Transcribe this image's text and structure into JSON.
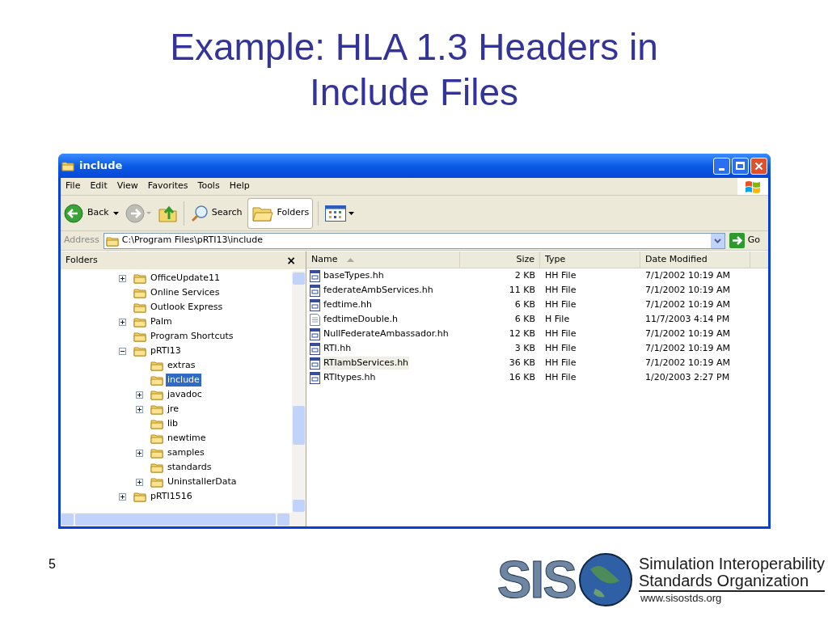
{
  "slide": {
    "title": "Example: HLA 1.3 Headers in Include Files",
    "page_number": "5"
  },
  "window": {
    "title": "include",
    "menu": [
      "File",
      "Edit",
      "View",
      "Favorites",
      "Tools",
      "Help"
    ],
    "toolbar": {
      "back": "Back",
      "search": "Search",
      "folders": "Folders",
      "folders_selected": true
    },
    "address": {
      "label": "Address",
      "value": "C:\\Program Files\\pRTI13\\include",
      "go": "Go"
    },
    "folders_pane": {
      "title": "Folders",
      "close": "×",
      "tree": [
        {
          "label": "OfficeUpdate11",
          "expanded": false,
          "selected": false
        },
        {
          "label": "Online Services",
          "selected": false
        },
        {
          "label": "Outlook Express",
          "selected": false
        },
        {
          "label": "Palm",
          "expanded": false,
          "selected": false
        },
        {
          "label": "Program Shortcuts",
          "selected": false
        },
        {
          "label": "pRTI13",
          "expanded": true,
          "selected": false,
          "children": [
            {
              "label": "extras",
              "selected": false
            },
            {
              "label": "include",
              "selected": true
            },
            {
              "label": "javadoc",
              "expanded": false,
              "selected": false
            },
            {
              "label": "jre",
              "expanded": false,
              "selected": false
            },
            {
              "label": "lib",
              "selected": false
            },
            {
              "label": "newtime",
              "selected": false
            },
            {
              "label": "samples",
              "expanded": false,
              "selected": false
            },
            {
              "label": "standards",
              "selected": false
            },
            {
              "label": "UninstallerData",
              "expanded": false,
              "selected": false
            }
          ]
        },
        {
          "label": "pRTI1516",
          "expanded": false,
          "selected": false
        }
      ]
    },
    "table": {
      "columns": [
        "Name",
        "Size",
        "Type",
        "Date Modified"
      ],
      "rows": [
        {
          "kind": "hh",
          "name": "baseTypes.hh",
          "size": "2 KB",
          "type": "HH File",
          "date": "7/1/2002 10:19 AM",
          "selected": false
        },
        {
          "kind": "hh",
          "name": "federateAmbServices.hh",
          "size": "11 KB",
          "type": "HH File",
          "date": "7/1/2002 10:19 AM",
          "selected": false
        },
        {
          "kind": "hh",
          "name": "fedtime.hh",
          "size": "6 KB",
          "type": "HH File",
          "date": "7/1/2002 10:19 AM",
          "selected": false
        },
        {
          "kind": "text",
          "name": "fedtimeDouble.h",
          "size": "6 KB",
          "type": "H File",
          "date": "11/7/2003 4:14 PM",
          "selected": false
        },
        {
          "kind": "hh",
          "name": "NullFederateAmbassador.hh",
          "size": "12 KB",
          "type": "HH File",
          "date": "7/1/2002 10:19 AM",
          "selected": false
        },
        {
          "kind": "hh",
          "name": "RTI.hh",
          "size": "3 KB",
          "type": "HH File",
          "date": "7/1/2002 10:19 AM",
          "selected": false
        },
        {
          "kind": "hh",
          "name": "RTIambServices.hh",
          "size": "36 KB",
          "type": "HH File",
          "date": "7/1/2002 10:19 AM",
          "selected": true
        },
        {
          "kind": "hh",
          "name": "RTItypes.hh",
          "size": "16 KB",
          "type": "HH File",
          "date": "1/20/2003 2:27 PM",
          "selected": false
        }
      ]
    }
  },
  "logo": {
    "mark": "SIS",
    "name_line_1": "Simulation Interoperability",
    "name_line_2": "Standards Organization",
    "url": "www.sisostds.org"
  }
}
